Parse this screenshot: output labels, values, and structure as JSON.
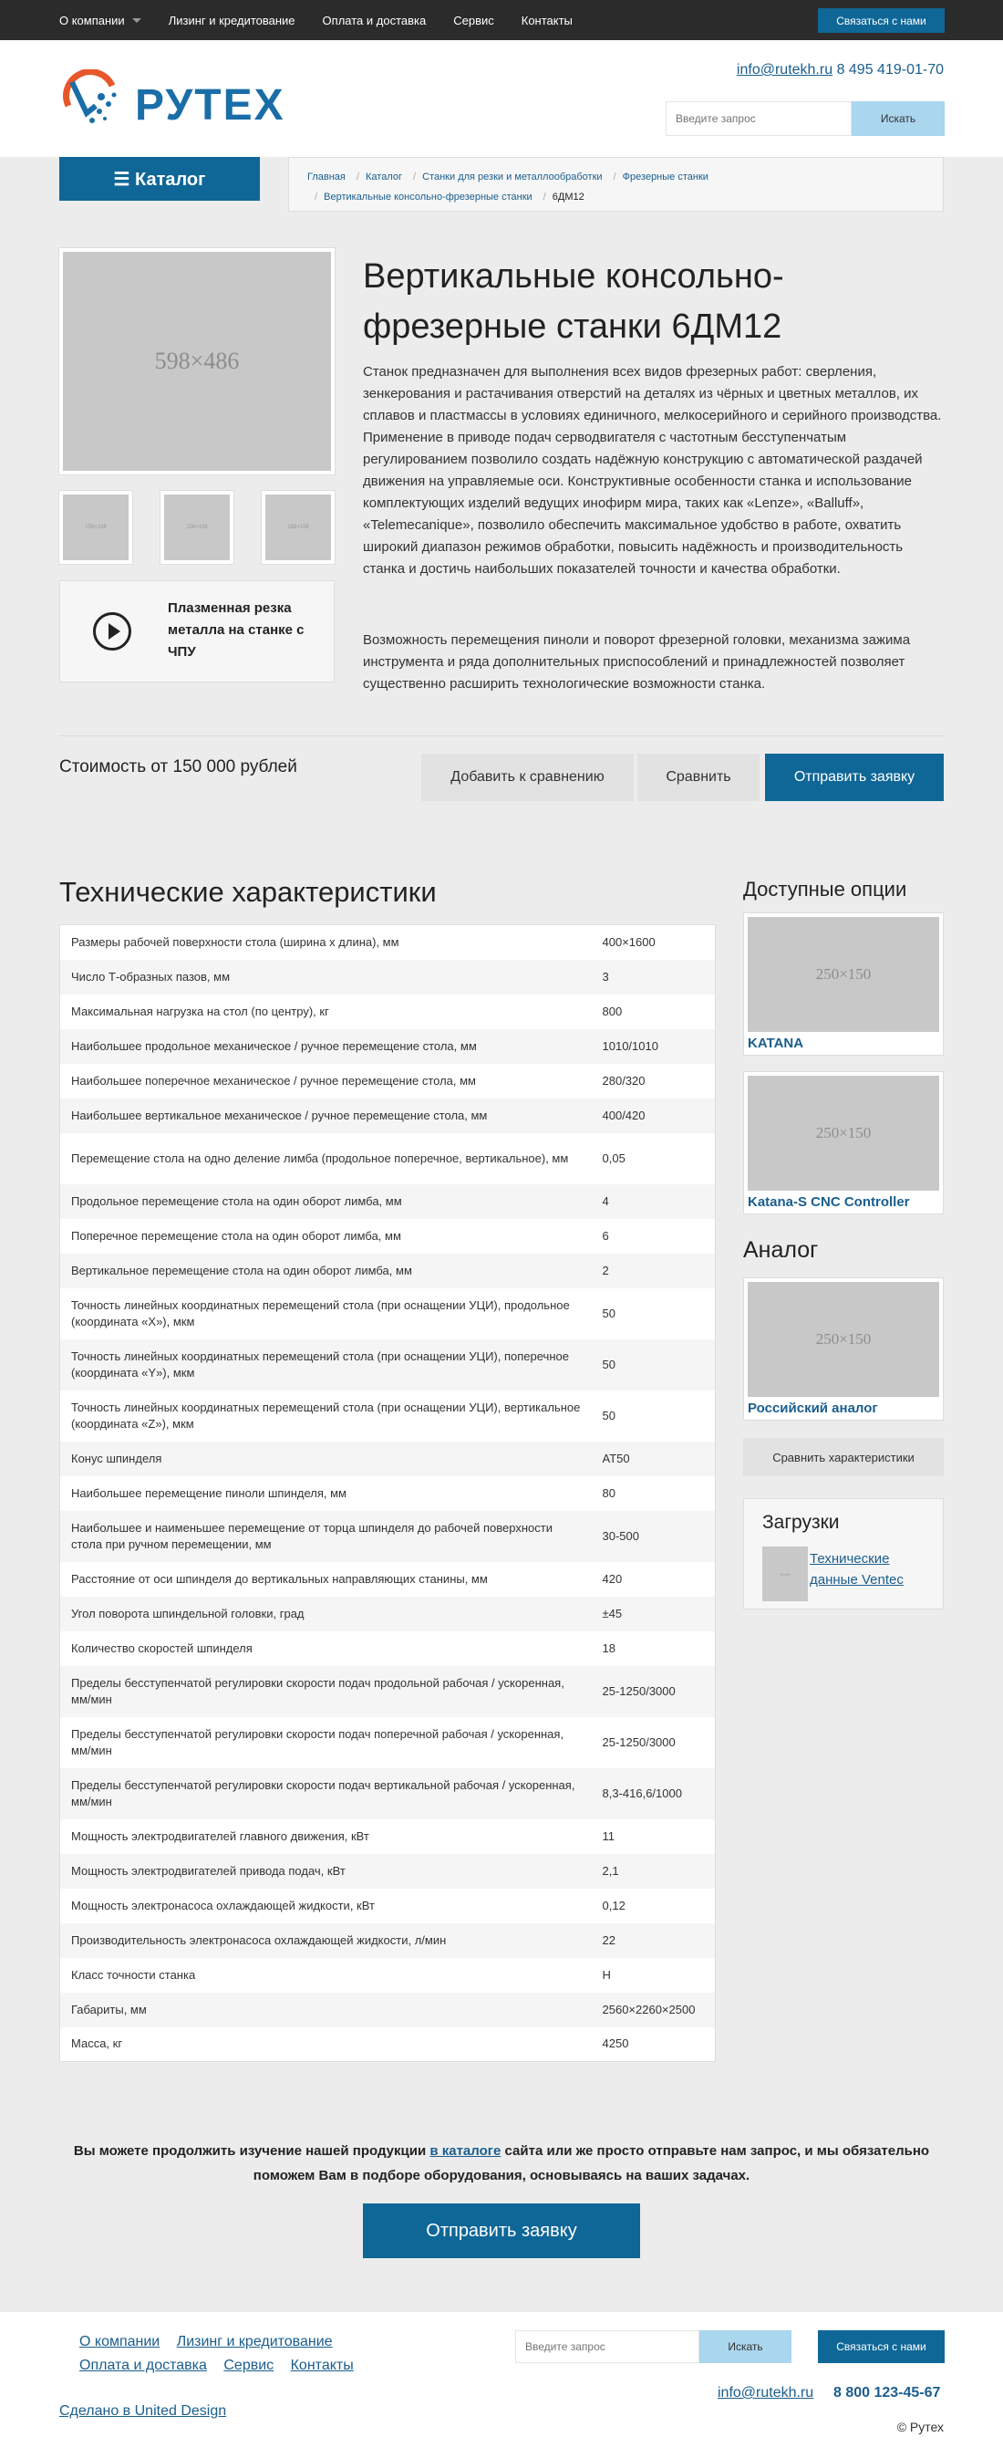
{
  "topnav": {
    "items": [
      "О компании",
      "Лизинг и кредитование",
      "Оплата и доставка",
      "Сервис",
      "Контакты"
    ],
    "contact_btn": "Связаться с нами"
  },
  "header": {
    "logo_text": "РУТЕХ",
    "email": "info@rutekh.ru",
    "phone": "8 495 419-01-70",
    "search_placeholder": "Введите запрос",
    "search_btn": "Искать"
  },
  "catalog_btn": "☰ Каталог",
  "breadcrumbs": [
    "Главная",
    "Каталог",
    "Станки для резки и металлообработки",
    "Фрезерные станки",
    "Вертикальные консольно-фрезерные станки",
    "6ДМ12"
  ],
  "product": {
    "main_image_label": "598×486",
    "thumb_label": "158×158",
    "video_title": "Плазменная резка металла на станке с ЧПУ",
    "title": "Вертикальные консольно-фрезерные станки 6ДМ12",
    "description": "Станок предназначен для выполнения всех видов фрезерных работ: сверления, зенкерования и растачивания отверстий на деталях из чёрных и цветных металлов, их сплавов и пластмассы в условиях единичного, мелкосерийного и серийного производства. Применение в приводе подач серводвигателя с частотным бесступенчатым регулированием позволило создать надёжную конструкцию с автоматической раздачей движения на управляемые оси. Конструктивные особенности станка и использование комплектующих изделий ведущих инофирм мира, таких как «Lenze», «Balluff», «Telemecanique», позволило обеспечить максимальное удобство в работе, охватить широкий диапазон режимов обработки, повысить надёжность и производительность станка и достичь наибольших показателей точности и качества обработки.",
    "description2": "Возможность перемещения пиноли и поворот фрезерной головки, механизма зажима инструмента и ряда дополнительных приспособлений и принадлежностей позволяет существенно расширить технологические возможности станка.",
    "price": "Стоимость от 150 000 рублей",
    "compare_add_btn": "Добавить к сравнению",
    "compare_btn": "Сравнить",
    "order_btn": "Отправить заявку"
  },
  "specs": {
    "title": "Технические характеристики",
    "rows": [
      {
        "name": "Размеры рабочей поверхности стола (ширина х длина), мм",
        "value": "400×1600"
      },
      {
        "name": "Число Т-образных пазов, мм",
        "value": "3"
      },
      {
        "name": "Максимальная нагрузка на стол (по центру), кг",
        "value": "800"
      },
      {
        "name": "Наибольшее продольное механическое / ручное перемещение стола, мм",
        "value": "1010/1010"
      },
      {
        "name": "Наибольшее поперечное механическое / ручное перемещение стола, мм",
        "value": "280/320"
      },
      {
        "name": "Наибольшее вертикальное механическое / ручное перемещение стола, мм",
        "value": "400/420"
      },
      {
        "name": "Перемещение стола на одно деление лимба (продольное поперечное, вертикальное), мм",
        "value": "0,05"
      },
      {
        "name": "Продольное перемещение стола на один оборот лимба, мм",
        "value": "4"
      },
      {
        "name": "Поперечное перемещение стола на один оборот лимба, мм",
        "value": "6"
      },
      {
        "name": "Вертикальное перемещение стола на один оборот лимба, мм",
        "value": "2"
      },
      {
        "name": "Точность линейных координатных перемещений стола (при оснащении УЦИ), продольное (координата «X»), мкм",
        "value": "50"
      },
      {
        "name": "Точность линейных координатных перемещений стола (при оснащении УЦИ), поперечное (координата «Y»), мкм",
        "value": "50"
      },
      {
        "name": "Точность линейных координатных перемещений стола (при оснащении УЦИ), вертикальное (координата «Z»), мкм",
        "value": "50"
      },
      {
        "name": "Конус шпинделя",
        "value": "AT50"
      },
      {
        "name": "Наибольшее перемещение пиноли шпинделя, мм",
        "value": "80"
      },
      {
        "name": "Наибольшее и наименьшее перемещение от торца шпинделя до рабочей поверхности стола при ручном перемещении, мм",
        "value": "30-500"
      },
      {
        "name": "Расстояние от оси шпинделя до вертикальных направляющих станины, мм",
        "value": "420"
      },
      {
        "name": "Угол поворота шпиндельной головки, град",
        "value": "±45"
      },
      {
        "name": "Количество скоростей шпинделя",
        "value": "18"
      },
      {
        "name": "Пределы бесступенчатой регулировки скорости подач продольной рабочая / ускоренная, мм/мин",
        "value": "25-1250/3000"
      },
      {
        "name": "Пределы бесступенчатой регулировки скорости подач поперечной рабочая / ускоренная, мм/мин",
        "value": "25-1250/3000"
      },
      {
        "name": "Пределы бесступенчатой регулировки скорости подач вертикальной рабочая / ускоренная, мм/мин",
        "value": "8,3-416,6/1000"
      },
      {
        "name": "Мощность электродвигателей главного движения, кВт",
        "value": "11"
      },
      {
        "name": "Мощность электродвигателей привода подач, кВт",
        "value": "2,1"
      },
      {
        "name": "Мощность электронасоса охлаждающей жидкости, кВт",
        "value": "0,12"
      },
      {
        "name": "Производительность электронасоса охлаждающей жидкости, л/мин",
        "value": "22"
      },
      {
        "name": "Класс точности станка",
        "value": "Н"
      },
      {
        "name": "Габариты, мм",
        "value": "2560×2260×2500"
      },
      {
        "name": "Масса, кг",
        "value": "4250"
      }
    ]
  },
  "sidebar": {
    "options_title": "Доступные опции",
    "options": [
      {
        "img": "250×150",
        "label": "KATANA"
      },
      {
        "img": "250×150",
        "label": "Katana-S CNC Controller"
      }
    ],
    "analog_title": "Аналог",
    "analog": {
      "img": "250×150",
      "label": "Российский аналог"
    },
    "compare_btn": "Сравнить характеристики",
    "downloads_title": "Загрузки",
    "download_img": "50×60",
    "download_link": "Технические данные Ventec"
  },
  "cta": {
    "text_before": "Вы можете продолжить изучение нашей продукции ",
    "link": "в каталоге",
    "text_after": " сайта или же просто отправьте нам запрос, и мы обязательно поможем Вам в подборе оборудования, основываясь на ваших задачах.",
    "btn": "Отправить заявку"
  },
  "footer": {
    "nav": [
      "О компании",
      "Лизинг и кредитование",
      "Оплата и доставка",
      "Сервис",
      "Контакты"
    ],
    "search_placeholder": "Введите запрос",
    "search_btn": "Искать",
    "contact_btn": "Связаться с нами",
    "email": "info@rutekh.ru",
    "phone": "8 800 123-45-67",
    "made_by": "Сделано в United Design",
    "copyright": "© Рутех"
  },
  "colors": {
    "accent": "#0f6797",
    "link": "#1a5e8e",
    "search_btn": "#aad6ee",
    "topbar": "#2b2b2b"
  }
}
